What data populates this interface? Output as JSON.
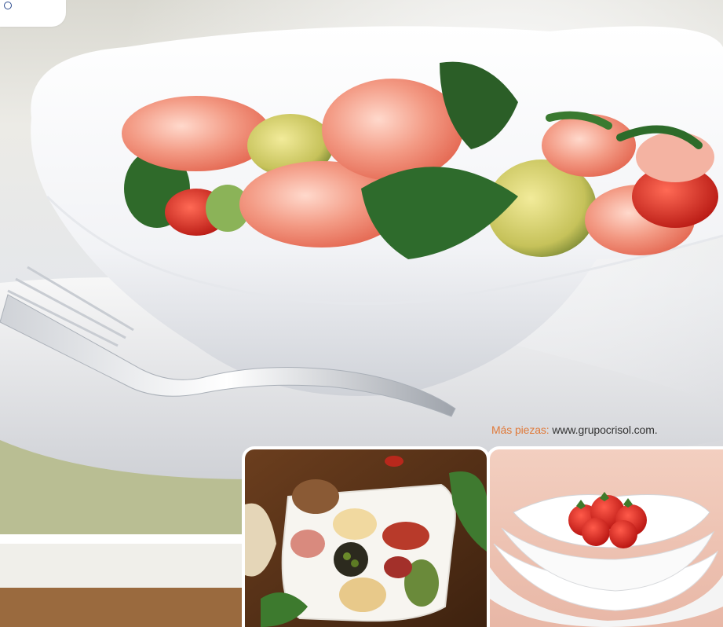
{
  "caption": {
    "label": "Más piezas:",
    "url": "www.grupocrisol.com."
  },
  "colors": {
    "accent_orange": "#e07a3a",
    "text_dark": "#333333",
    "logo_blue": "#2c4b8e"
  },
  "icons": {
    "corner": "circle-logo-icon"
  },
  "images": {
    "hero": "shrimp-avocado-salad-in-white-bowl-with-fork",
    "thumb_1": "appetizer-platter-on-white-rectangular-dish",
    "thumb_2": "strawberries-in-stacked-white-bowls"
  }
}
